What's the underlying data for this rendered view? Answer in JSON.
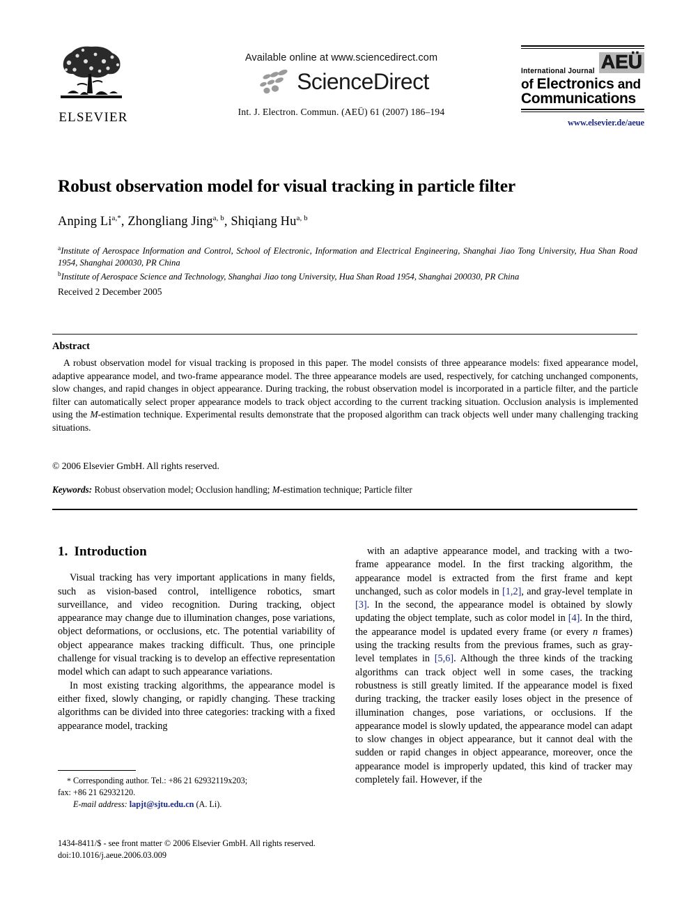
{
  "header": {
    "publisher_logo_name": "ELSEVIER",
    "sciencedirect": {
      "available_line": "Available online at www.sciencedirect.com",
      "wordmark": "ScienceDirect"
    },
    "journal_reference": "Int. J. Electron. Commun. (AEÜ) 61 (2007) 186–194",
    "journal_logo": {
      "badge": "AEÜ",
      "line1": "International Journal",
      "line2_a": "of ",
      "line2_b": "Electronics",
      "line2_c": " and",
      "line3": "Communications",
      "url": "www.elsevier.de/aeue",
      "url_color": "#1b2a86"
    }
  },
  "article": {
    "title": "Robust observation model for visual tracking in particle filter",
    "authors": "Anping Li",
    "authors_full": [
      {
        "name": "Anping Li",
        "marks": "a,*"
      },
      {
        "name": "Zhongliang Jing",
        "marks": "a, b"
      },
      {
        "name": "Shiqiang Hu",
        "marks": "a, b"
      }
    ],
    "affiliations": [
      {
        "mark": "a",
        "text": "Institute of Aerospace Information and Control, School of Electronic, Information and Electrical Engineering, Shanghai Jiao Tong University, Hua Shan Road 1954, Shanghai 200030, PR China"
      },
      {
        "mark": "b",
        "text": "Institute of Aerospace Science and Technology, Shanghai Jiao tong University, Hua Shan Road 1954, Shanghai 200030, PR China"
      }
    ],
    "received": "Received 2 December 2005"
  },
  "abstract": {
    "heading": "Abstract",
    "body_part1": "A robust observation model for visual tracking is proposed in this paper. The model consists of three appearance models: fixed appearance model, adaptive appearance model, and two-frame appearance model. The three appearance models are used, respectively, for catching unchanged components, slow changes, and rapid changes in object appearance. During tracking, the robust observation model is incorporated in a particle filter, and the particle filter can automatically select proper appearance models to track object according to the current tracking situation. Occlusion analysis is implemented using the ",
    "body_italic": "M",
    "body_part2": "-estimation technique. Experimental results demonstrate that the proposed algorithm can track objects well under many challenging tracking situations.",
    "copyright": "© 2006 Elsevier GmbH. All rights reserved."
  },
  "keywords": {
    "label": "Keywords:",
    "part1": " Robust observation model; Occlusion handling; ",
    "italic": "M",
    "part2": "-estimation technique; Particle filter"
  },
  "body": {
    "section_number": "1.",
    "section_title": "Introduction",
    "left_paragraphs": [
      "Visual tracking has very important applications in many fields, such as vision-based control, intelligence robotics, smart surveillance, and video recognition. During tracking, object appearance may change due to illumination changes, pose variations, object deformations, or occlusions, etc. The potential variability of object appearance makes tracking difficult. Thus, one principle challenge for visual tracking is to develop an effective representation model which can adapt to such appearance variations.",
      "In most existing tracking algorithms, the appearance model is either fixed, slowly changing, or rapidly changing. These tracking algorithms can be divided into three categories: tracking with a fixed appearance model, tracking"
    ],
    "right_paragraph_segments": [
      {
        "type": "text",
        "value": "with an adaptive appearance model, and tracking with a two-frame appearance model. In the first tracking algorithm, the appearance model is extracted from the first frame and kept unchanged, such as color models in "
      },
      {
        "type": "ref",
        "value": "[1,2]"
      },
      {
        "type": "text",
        "value": ", and gray-level template in "
      },
      {
        "type": "ref",
        "value": "[3]"
      },
      {
        "type": "text",
        "value": ". In the second, the appearance model is obtained by slowly updating the object template, such as color model in "
      },
      {
        "type": "ref",
        "value": "[4]"
      },
      {
        "type": "text",
        "value": ". In the third, the appearance model is updated every frame (or every "
      },
      {
        "type": "italic",
        "value": "n"
      },
      {
        "type": "text",
        "value": " frames) using the tracking results from the previous frames, such as gray-level templates in "
      },
      {
        "type": "ref",
        "value": "[5,6]"
      },
      {
        "type": "text",
        "value": ". Although the three kinds of the tracking algorithms can track object well in some cases, the tracking robustness is still greatly limited. If the appearance model is fixed during tracking, the tracker easily loses object in the presence of illumination changes, pose variations, or occlusions. If the appearance model is slowly updated, the appearance model can adapt to slow changes in object appearance, but it cannot deal with the sudden or rapid changes in object appearance, moreover, once the appearance model is improperly updated, this kind of tracker may completely fail. However, if the"
      }
    ]
  },
  "footnote": {
    "corresponding_marker": "*",
    "corresponding_text": " Corresponding author. Tel.: +86 21 62932119x203;",
    "fax_text": "fax: +86 21 62932120.",
    "email_label": "E-mail address:",
    "email_address": "lapjt@sjtu.edu.cn",
    "email_attribution": "(A. Li).",
    "email_color": "#1b2a86"
  },
  "imprint": {
    "line1": "1434-8411/$ - see front matter © 2006 Elsevier GmbH. All rights reserved.",
    "line2": "doi:10.1016/j.aeue.2006.03.009"
  }
}
